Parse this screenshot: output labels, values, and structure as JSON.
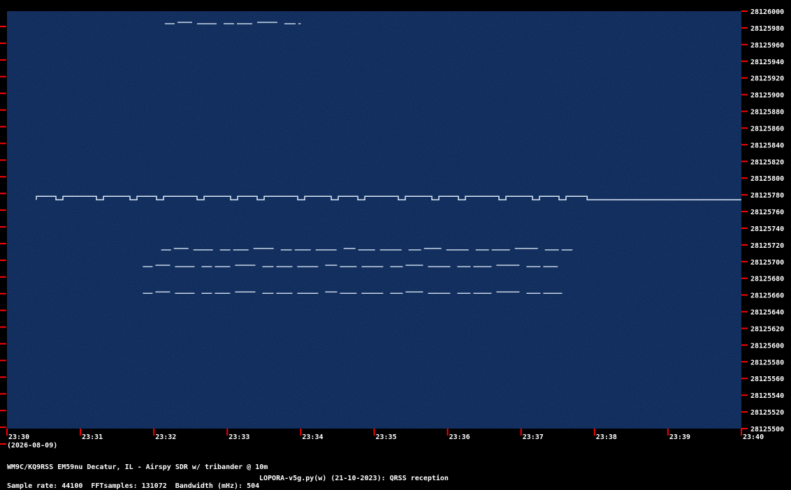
{
  "chart_data": {
    "type": "heatmap",
    "title": "",
    "xlabel": "",
    "ylabel": "",
    "date_label": "(2026-08-09)",
    "x_ticks": [
      "23:30",
      "23:31",
      "23:32",
      "23:33",
      "23:34",
      "23:35",
      "23:36",
      "23:37",
      "23:38",
      "23:39",
      "23:40"
    ],
    "y_ticks": [
      28126000,
      28125980,
      28125960,
      28125940,
      28125920,
      28125900,
      28125880,
      28125860,
      28125840,
      28125820,
      28125800,
      28125780,
      28125760,
      28125740,
      28125720,
      28125700,
      28125680,
      28125660,
      28125640,
      28125620,
      28125600,
      28125580,
      28125560,
      28125540,
      28125520,
      28125500
    ],
    "x_range_minutes": [
      0,
      10
    ],
    "ylim": [
      28125500,
      28126000
    ],
    "colors": {
      "background": "#0b1f4a",
      "signal": "#e8f4ff",
      "tick_mark": "#ff0000",
      "text": "#ffffff"
    },
    "signals": [
      {
        "label": "carrier",
        "freq": 28125774,
        "t_start": 0.4,
        "t_end": 10.0,
        "keyed_until": 7.9
      },
      {
        "label": "trace",
        "freq": 28125714,
        "t_start": 2.1,
        "t_end": 7.7
      },
      {
        "label": "trace",
        "freq": 28125694,
        "t_start": 1.85,
        "t_end": 7.5
      },
      {
        "label": "trace",
        "freq": 28125662,
        "t_start": 1.85,
        "t_end": 7.6
      },
      {
        "label": "trace",
        "freq": 28125985,
        "t_start": 2.15,
        "t_end": 4.0
      }
    ]
  },
  "footer": {
    "station": "WM9C/KQ9RSS EM59nu Decatur, IL - Airspy SDR w/ tribander @ 10m",
    "sample_rate": "Sample rate: 44100",
    "fft_samples": "FFTsamples: 131072",
    "bandwidth": "Bandwidth (mHz): 504",
    "software": "LOPORA-v5g.py(w) (21-10-2023): QRSS reception"
  }
}
